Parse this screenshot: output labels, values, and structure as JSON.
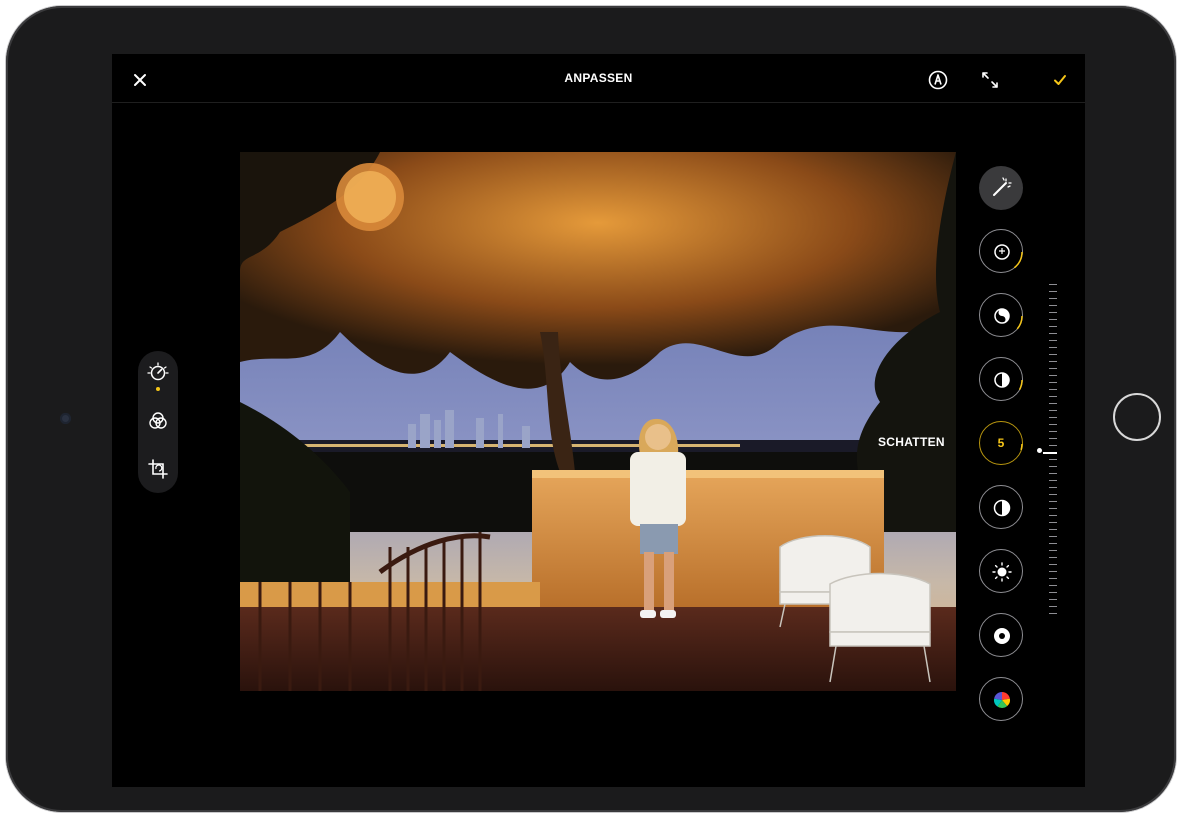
{
  "topbar": {
    "title": "ANPASSEN",
    "icons": {
      "close": "close-icon",
      "markup": "markup-pen-icon",
      "expand": "expand-arrows-icon",
      "done": "checkmark-icon"
    },
    "accent_color": "#f5c518"
  },
  "left_tools": [
    {
      "name": "adjust",
      "icon": "adjust-dial-icon",
      "active": true
    },
    {
      "name": "filters",
      "icon": "filters-circles-icon",
      "active": false
    },
    {
      "name": "crop",
      "icon": "crop-rotate-icon",
      "active": false
    }
  ],
  "adjustments": {
    "active_label": "SCHATTEN",
    "active_value": "5",
    "slider_level_fraction": 0.05,
    "buttons": [
      {
        "name": "auto",
        "icon": "magic-wand-icon"
      },
      {
        "name": "exposure",
        "icon": "exposure-icon"
      },
      {
        "name": "brilliance",
        "icon": "brilliance-icon"
      },
      {
        "name": "highlights",
        "icon": "highlights-icon"
      },
      {
        "name": "shadows",
        "icon": "shadows-icon",
        "selected": true
      },
      {
        "name": "contrast",
        "icon": "contrast-icon"
      },
      {
        "name": "brightness",
        "icon": "brightness-sun-icon"
      },
      {
        "name": "black-point",
        "icon": "black-point-icon"
      },
      {
        "name": "saturation",
        "icon": "saturation-color-wheel-icon"
      }
    ]
  }
}
